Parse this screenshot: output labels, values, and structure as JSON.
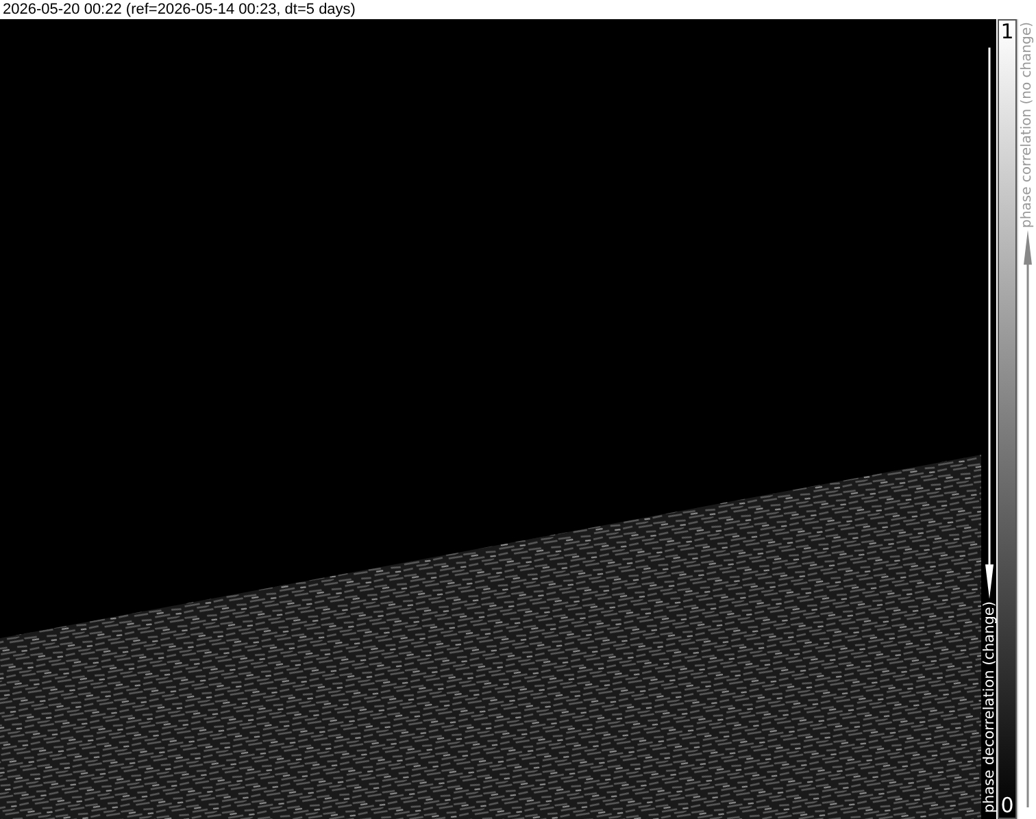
{
  "header": {
    "timestamp": "2026-05-20 00:22 (ref=2026-05-14 00:23, dt=5 days)"
  },
  "colorbar": {
    "max_label": "1",
    "min_label": "0",
    "upper_caption": "phase correlation (no change)",
    "lower_caption": "phase decorrelation (change)"
  }
}
